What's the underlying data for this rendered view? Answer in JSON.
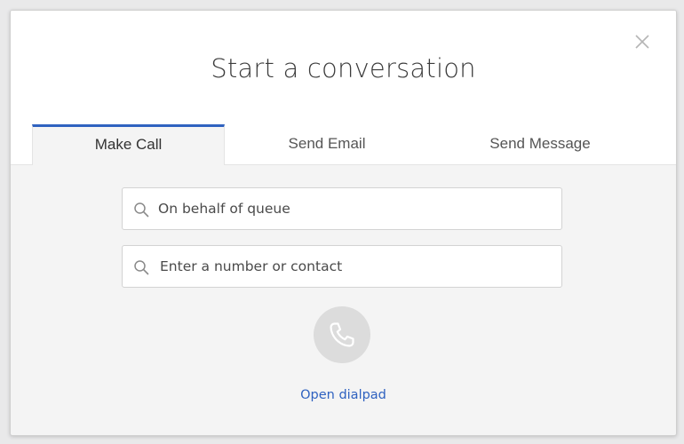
{
  "dialog": {
    "title": "Start a conversation",
    "close_icon": "close-icon"
  },
  "tabs": [
    {
      "label": "Make Call",
      "active": true
    },
    {
      "label": "Send Email",
      "active": false
    },
    {
      "label": "Send Message",
      "active": false
    }
  ],
  "make_call": {
    "queue_field": {
      "placeholder": "On behalf of queue",
      "value": "",
      "icon": "search-icon"
    },
    "contact_field": {
      "placeholder": "Enter a number or contact",
      "value": "",
      "icon": "search-icon"
    },
    "call_button_icon": "phone-icon",
    "dialpad_link": "Open dialpad"
  },
  "colors": {
    "accent": "#2f62c0",
    "background": "#f4f4f4",
    "header_background": "#ffffff",
    "call_button_background": "#dcdcdc"
  }
}
